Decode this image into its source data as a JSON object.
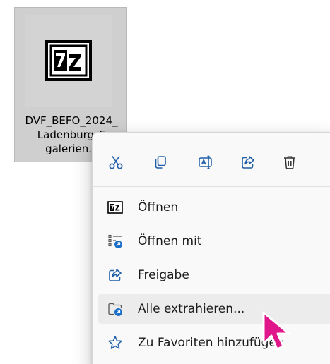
{
  "file": {
    "icon": "7z-archive-icon",
    "icon_text": "7z",
    "name_lines": [
      "DVF_BEFO_2024_",
      "Ladenburg_F",
      "galerien.z"
    ]
  },
  "context_menu": {
    "quick_actions": [
      {
        "icon": "scissors-icon",
        "label": "Ausschneiden"
      },
      {
        "icon": "copy-icon",
        "label": "Kopieren"
      },
      {
        "icon": "rename-icon",
        "label": "Umbenennen"
      },
      {
        "icon": "share-icon",
        "label": "Freigeben"
      },
      {
        "icon": "trash-icon",
        "label": "Löschen"
      }
    ],
    "items": [
      {
        "icon": "7zip-icon",
        "label": "Öffnen"
      },
      {
        "icon": "open-with-icon",
        "label": "Öffnen mit"
      },
      {
        "icon": "share-icon",
        "label": "Freigabe"
      },
      {
        "icon": "extract-folder-icon",
        "label": "Alle extrahieren..."
      },
      {
        "icon": "star-icon",
        "label": "Zu Favoriten hinzufügen"
      }
    ],
    "hovered_item": "Alle extrahieren..."
  },
  "colors": {
    "accent": "#0067c0",
    "cursor": "#e0178a",
    "selection": "#cfcfcf",
    "menu_bg": "#f9f9f9"
  }
}
